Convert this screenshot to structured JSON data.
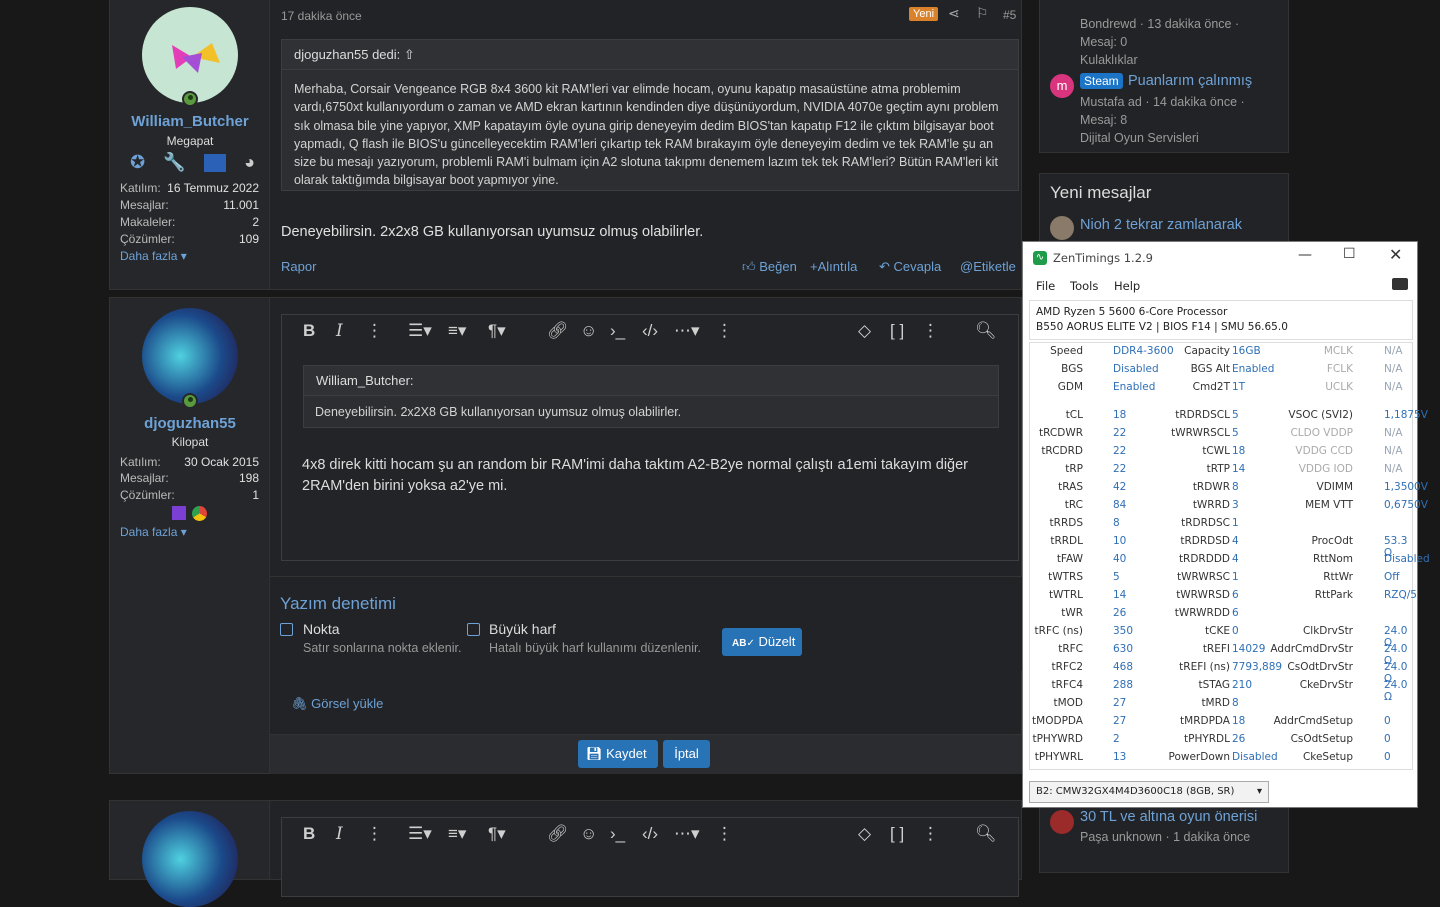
{
  "post1": {
    "time": "17 dakika önce",
    "badge": "Yeni",
    "num": "#5",
    "user": {
      "name": "William_Butcher",
      "title": "Megapat",
      "stats": [
        {
          "k": "Katılım:",
          "v": "16 Temmuz 2022"
        },
        {
          "k": "Mesajlar:",
          "v": "11.001"
        },
        {
          "k": "Makaleler:",
          "v": "2"
        },
        {
          "k": "Çözümler:",
          "v": "109"
        }
      ],
      "more": "Daha fazla"
    },
    "quote_head": "djoguzhan55 dedi:",
    "quote_body": "Merhaba, Corsair Vengeance RGB 8x4 3600 kit RAM'leri var elimde hocam, oyunu kapatıp masaüstüne atma problemim vardı,6750xt kullanıyordum o zaman ve AMD ekran kartının kendinden diye düşünüyordum, NVIDIA 4070e geçtim aynı problem sık olmasa bile yine yapıyor, XMP kapatayım öyle oyuna girip deneyeyim dedim BIOS'tan kapatıp F12 ile çıktım bilgisayar boot yapmadı, Q flash ile BIOS'u güncelleyecektim RAM'leri çıkartıp tek RAM bırakayım öyle deneyeyim dedim ve tek RAM'le şu an size bu mesajı yazıyorum, problemli RAM'i bulmam için A2 slotuna takıpmı denemem lazım tek tek RAM'leri? Bütün RAM'leri kit olarak taktığımda bilgisayar boot yapmıyor yine.",
    "body": "Deneyebilirsin. 2x2x8 GB kullanıyorsan uyumsuz olmuş olabilirler.",
    "report": "Rapor",
    "actions": {
      "like": "Beğen",
      "quote": "+Alıntıla",
      "reply": "Cevapla",
      "tag": "Etiketle"
    }
  },
  "post2": {
    "user": {
      "name": "djoguzhan55",
      "title": "Kilopat",
      "stats": [
        {
          "k": "Katılım:",
          "v": "30 Ocak 2015"
        },
        {
          "k": "Mesajlar:",
          "v": "198"
        },
        {
          "k": "Çözümler:",
          "v": "1"
        }
      ],
      "more": "Daha fazla"
    },
    "quote_head": "William_Butcher:",
    "quote_body": "Deneyebilirsin. 2x2X8 GB kullanıyorsan uyumsuz olmuş olabilirler.",
    "body": "4x8 direk kitti hocam şu an random bir RAM'imi daha taktım A2-B2ye normal çalıştı a1emi takayım diğer 2RAM'den birini yoksa a2'ye mi.",
    "spell": {
      "title": "Yazım denetimi",
      "opt1": "Nokta",
      "opt1_desc": "Satır sonlarına nokta eklenir.",
      "opt2": "Büyük harf",
      "opt2_desc": "Hatalı büyük harf kullanımı düzenlenir.",
      "fix": "Düzelt"
    },
    "upload": "Görsel yükle",
    "save": "Kaydet",
    "cancel": "İptal"
  },
  "sidebar": {
    "top": [
      {
        "meta": "Bondrewd · 13 dakika önce ·",
        "msg": "Mesaj: 0",
        "cat": "Kulaklıklar"
      },
      {
        "tag": "Steam",
        "title": "Puanlarım çalınmış",
        "meta": "Mustafa ad · 14 dakika önce ·",
        "msg": "Mesaj: 8",
        "cat": "Dijital Oyun Servisleri"
      }
    ],
    "new_title": "Yeni mesajlar",
    "new_first": "Nioh 2 tekrar zamlanarak",
    "bottom": {
      "title": "30 TL ve altına oyun önerisi",
      "meta": "Paşa unknown · 1 dakika önce"
    }
  },
  "zen": {
    "title": "ZenTimings 1.2.9",
    "menu": [
      "File",
      "Tools",
      "Help"
    ],
    "cpu": "AMD Ryzen 5 5600 6-Core Processor",
    "board": "B550 AORUS ELITE V2 | BIOS F14 | SMU 56.65.0",
    "top": [
      [
        "Speed",
        "DDR4-3600",
        "Capacity",
        "16GB",
        "MCLK",
        "N/A"
      ],
      [
        "BGS",
        "Disabled",
        "BGS Alt",
        "Enabled",
        "FCLK",
        "N/A"
      ],
      [
        "GDM",
        "Enabled",
        "Cmd2T",
        "1T",
        "UCLK",
        "N/A"
      ]
    ],
    "rows": [
      [
        "tCL",
        "18",
        "tRDRDSCL",
        "5",
        "VSOC (SVI2)",
        "1,1875V"
      ],
      [
        "tRCDWR",
        "22",
        "tWRWRSCL",
        "5",
        "CLDO VDDP",
        "N/A"
      ],
      [
        "tRCDRD",
        "22",
        "tCWL",
        "18",
        "VDDG CCD",
        "N/A"
      ],
      [
        "tRP",
        "22",
        "tRTP",
        "14",
        "VDDG IOD",
        "N/A"
      ],
      [
        "tRAS",
        "42",
        "tRDWR",
        "8",
        "VDIMM",
        "1,3500V"
      ],
      [
        "tRC",
        "84",
        "tWRRD",
        "3",
        "MEM VTT",
        "0,6750V"
      ],
      [
        "tRRDS",
        "8",
        "tRDRDSC",
        "1",
        "",
        ""
      ],
      [
        "tRRDL",
        "10",
        "tRDRDSD",
        "4",
        "ProcOdt",
        "53.3 Ω"
      ],
      [
        "tFAW",
        "40",
        "tRDRDDD",
        "4",
        "RttNom",
        "Disabled"
      ],
      [
        "tWTRS",
        "5",
        "tWRWRSC",
        "1",
        "RttWr",
        "Off"
      ],
      [
        "tWTRL",
        "14",
        "tWRWRSD",
        "6",
        "RttPark",
        "RZQ/5"
      ],
      [
        "tWR",
        "26",
        "tWRWRDD",
        "6",
        "",
        ""
      ],
      [
        "tRFC (ns)",
        "350",
        "tCKE",
        "0",
        "ClkDrvStr",
        "24.0 Ω"
      ],
      [
        "tRFC",
        "630",
        "tREFI",
        "14029",
        "AddrCmdDrvStr",
        "24.0 Ω"
      ],
      [
        "tRFC2",
        "468",
        "tREFI (ns)",
        "7793,889",
        "CsOdtDrvStr",
        "24.0 Ω"
      ],
      [
        "tRFC4",
        "288",
        "tSTAG",
        "210",
        "CkeDrvStr",
        "24.0 Ω"
      ],
      [
        "tMOD",
        "27",
        "tMRD",
        "8",
        "",
        ""
      ],
      [
        "tMODPDA",
        "27",
        "tMRDPDA",
        "18",
        "AddrCmdSetup",
        "0"
      ],
      [
        "tPHYWRD",
        "2",
        "tPHYRDL",
        "26",
        "CsOdtSetup",
        "0"
      ],
      [
        "tPHYWRL",
        "13",
        "PowerDown",
        "Disabled",
        "CkeSetup",
        "0"
      ]
    ],
    "dimm": "B2: CMW32GX4M4D3600C18 (8GB, SR)"
  }
}
